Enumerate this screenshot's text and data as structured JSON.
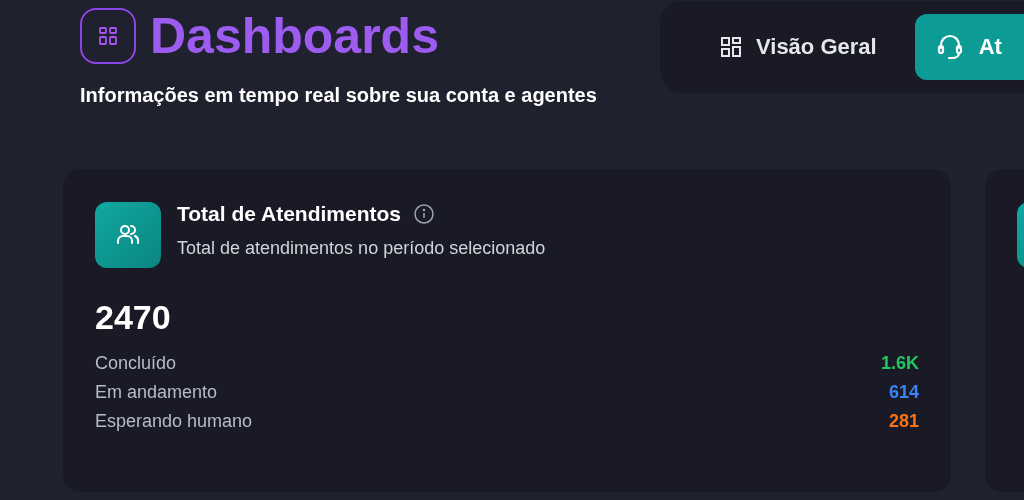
{
  "header": {
    "title": "Dashboards",
    "subtitle": "Informações em tempo real sobre sua conta e agentes"
  },
  "tabs": [
    {
      "label": "Visão Geral",
      "kind": "grid",
      "selected": false
    },
    {
      "label": "At",
      "kind": "headset",
      "selected": true
    }
  ],
  "cards": [
    {
      "kind": "stat",
      "title": "Total de Atendimentos",
      "description": "Total de atendimentos no período selecionado",
      "total": "2470",
      "rows": [
        {
          "label": "Concluído",
          "value": "1.6K",
          "color": "#22c55e"
        },
        {
          "label": "Em andamento",
          "value": "614",
          "color": "#3b82f6"
        },
        {
          "label": "Esperando humano",
          "value": "281",
          "color": "#f97316"
        }
      ]
    },
    {
      "kind": "partial"
    }
  ]
}
